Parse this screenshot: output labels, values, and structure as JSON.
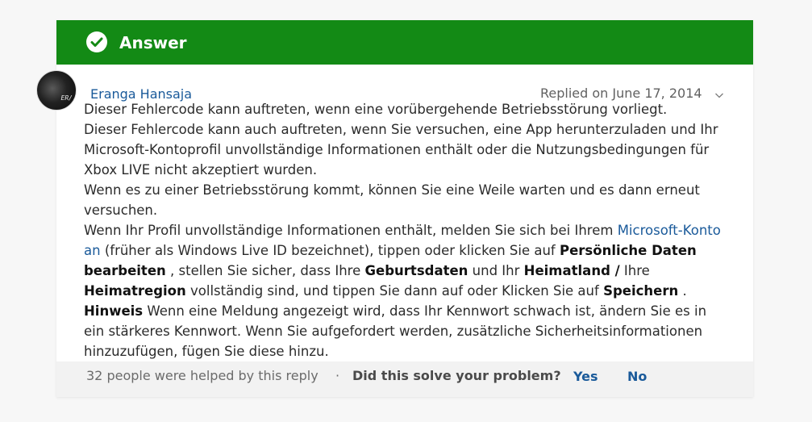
{
  "header": {
    "label": "Answer",
    "color": "#138a15"
  },
  "reply": {
    "author": "Eranga Hansaja",
    "avatar_text": "ER/",
    "replied_on": "Replied on June 17, 2014",
    "paragraphs": {
      "p1": "Dieser Fehlercode kann auftreten, wenn eine vorübergehende Betriebsstörung vorliegt.",
      "p2": "Dieser Fehlercode kann auch auftreten, wenn Sie versuchen, eine App herunterzuladen und Ihr Microsoft-Kontoprofil unvollständige Informationen enthält oder die Nutzungsbedingungen für Xbox LIVE nicht akzeptiert wurden.",
      "p3": "Wenn es zu einer Betriebsstörung kommt, können Sie eine Weile warten und es dann erneut versuchen.",
      "p4_start": "Wenn Ihr Profil unvollständige Informationen enthält, melden Sie sich bei Ihrem ",
      "p4_link": "Microsoft-Konto an",
      "p4_mid1": " (früher als Windows Live ID bezeichnet), tippen oder klicken Sie auf ",
      "p4_bold1": "Persönliche Daten bearbeiten",
      "p4_mid2": " , stellen Sie sicher, dass Ihre ",
      "p4_bold2": "Geburtsdaten",
      "p4_mid3": " und Ihr ",
      "p4_bold3": "Heimatland /",
      "p4_mid4": " Ihre ",
      "p4_bold4": "Heimatregion",
      "p4_mid5": " vollständig sind, und tippen Sie dann auf oder Klicken Sie auf ",
      "p4_bold5": "Speichern",
      "p4_end": " .",
      "p5_bold": "Hinweis",
      "p5_text": " Wenn eine Meldung angezeigt wird, dass Ihr Kennwort schwach ist, ändern Sie es in ein stärkeres Kennwort. Wenn Sie aufgefordert werden, zusätzliche Sicherheitsinformationen hinzuzufügen, fügen Sie diese hinzu."
    }
  },
  "footer": {
    "helped": "32 people were helped by this reply",
    "separator": "·",
    "question": "Did this solve your problem?",
    "yes": "Yes",
    "no": "No"
  },
  "icons": {
    "answer": "checkmark-circle-icon",
    "expand": "chevron-down-icon"
  }
}
